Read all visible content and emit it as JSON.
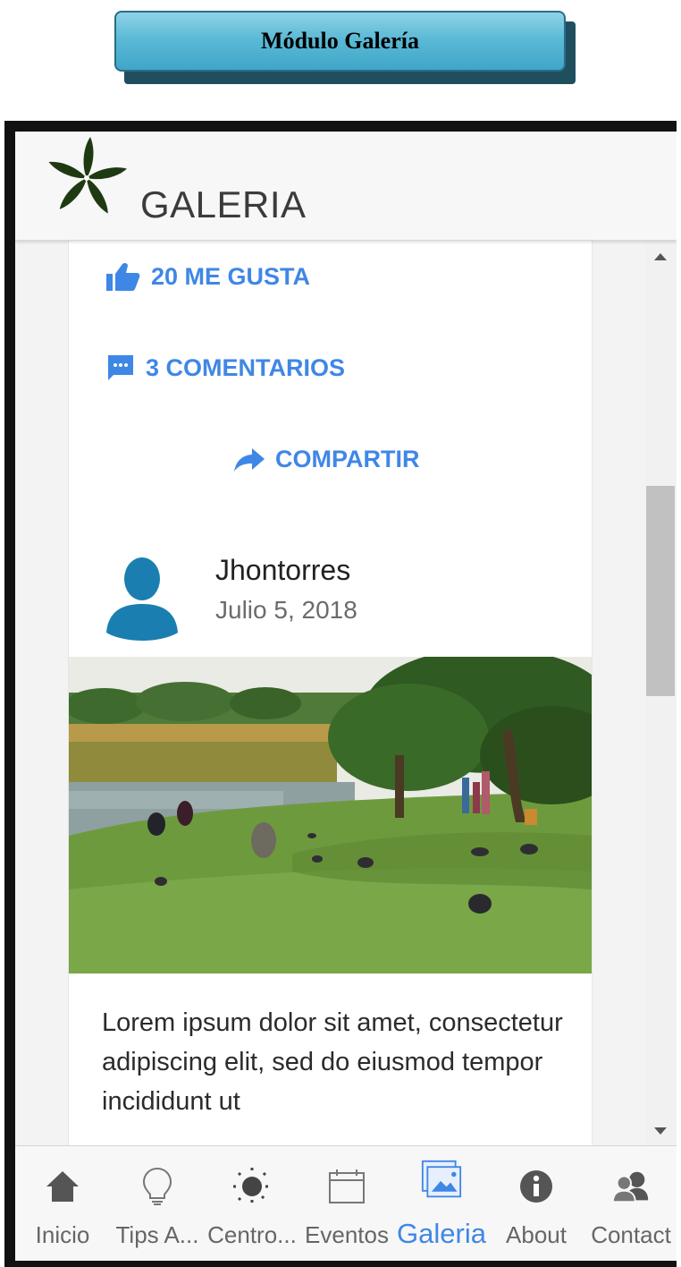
{
  "module_banner": {
    "title": "Módulo Galería"
  },
  "app_header": {
    "title": "GALERIA",
    "logo_icon": "flower-logo-icon"
  },
  "post_actions": {
    "likes_label": "20 ME GUSTA",
    "comments_label": "3 COMENTARIOS",
    "share_label": "COMPARTIR"
  },
  "post": {
    "author": "Jhontorres",
    "date": "Julio 5, 2018",
    "photo_icon": "park-photo",
    "caption": "Lorem ipsum dolor sit amet, consectetur adipiscing elit, sed do eiusmod tempor incididunt ut"
  },
  "bottom_nav": {
    "items": [
      {
        "label": "Inicio",
        "icon": "home-icon"
      },
      {
        "label": "Tips A...",
        "icon": "lightbulb-icon"
      },
      {
        "label": "Centro...",
        "icon": "sun-icon"
      },
      {
        "label": "Eventos",
        "icon": "calendar-icon"
      },
      {
        "label": "Galeria",
        "icon": "gallery-icon",
        "active": true
      },
      {
        "label": "About",
        "icon": "info-icon"
      },
      {
        "label": "Contact",
        "icon": "contacts-icon"
      }
    ]
  },
  "colors": {
    "accent": "#3f87e6",
    "avatar": "#1a7fb0",
    "banner": "#5cbad6"
  }
}
